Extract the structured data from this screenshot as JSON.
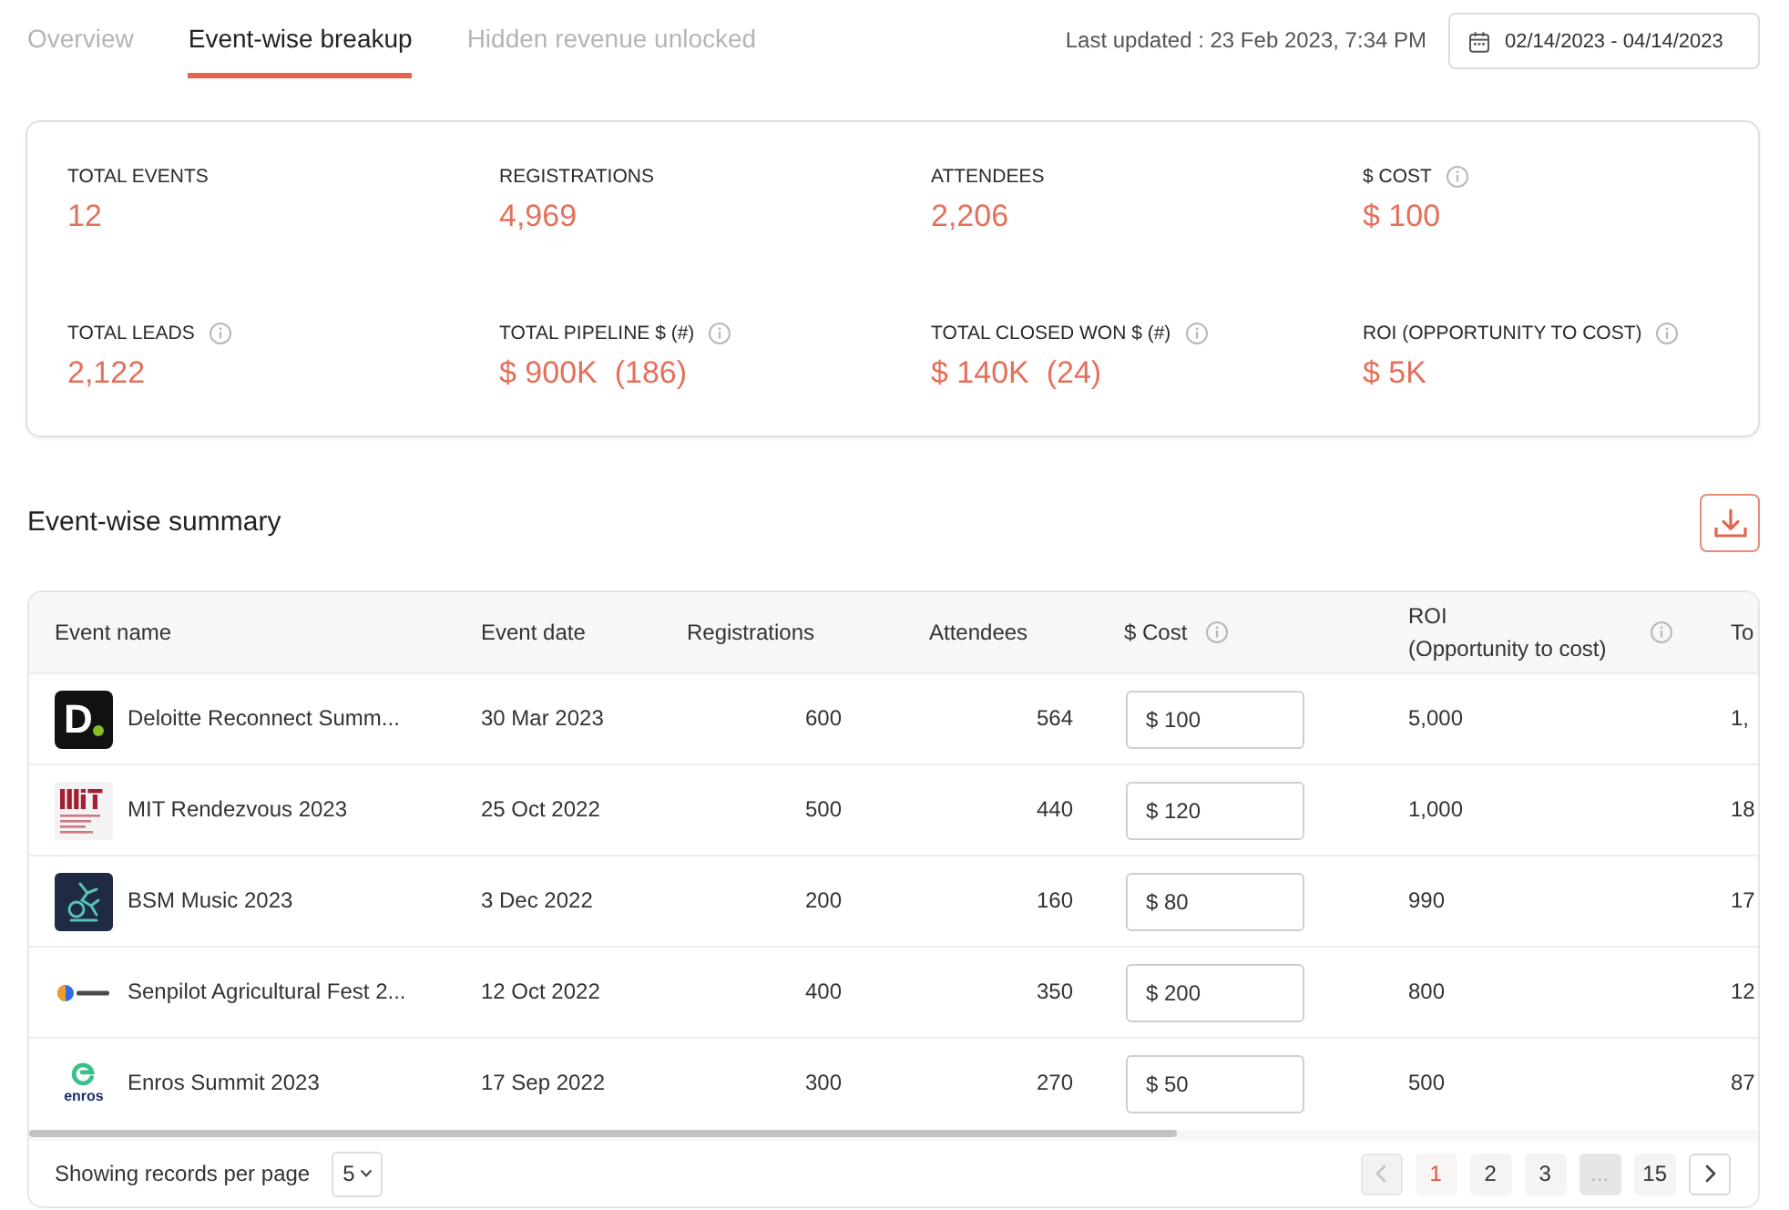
{
  "tabs": [
    {
      "label": "Overview",
      "selected": false
    },
    {
      "label": "Event-wise breakup",
      "selected": true
    },
    {
      "label": "Hidden revenue unlocked",
      "selected": false
    }
  ],
  "last_updated": "Last updated : 23 Feb 2023, 7:34 PM",
  "date_range": "02/14/2023 - 04/14/2023",
  "stats": [
    {
      "label": "TOTAL EVENTS",
      "value": "12",
      "info": false
    },
    {
      "label": "REGISTRATIONS",
      "value": "4,969",
      "info": false
    },
    {
      "label": "ATTENDEES",
      "value": "2,206",
      "info": false
    },
    {
      "label": "$ COST",
      "value": "$ 100",
      "info": true
    },
    {
      "label": "TOTAL LEADS",
      "value": "2,122",
      "info": true
    },
    {
      "label": "TOTAL PIPELINE $ (#)",
      "value": "$ 900K  (186)",
      "info": true
    },
    {
      "label": "TOTAL CLOSED WON $ (#)",
      "value": "$ 140K  (24)",
      "info": true
    },
    {
      "label": "ROI (OPPORTUNITY TO COST)",
      "value": "$ 5K",
      "info": true
    }
  ],
  "summary": {
    "title": "Event-wise summary"
  },
  "table": {
    "columns": [
      {
        "label": "Event name",
        "info": false
      },
      {
        "label": "Event date",
        "info": false
      },
      {
        "label": "Registrations",
        "info": false
      },
      {
        "label": "Attendees",
        "info": false
      },
      {
        "label": "$ Cost",
        "info": true
      },
      {
        "label": "ROI",
        "sublabel": "(Opportunity to cost)",
        "info": true
      },
      {
        "label": "To",
        "info": false
      }
    ],
    "rows": [
      {
        "logo": {
          "kind": "letter-tile",
          "text": "D"
        },
        "event_name": "Deloitte Reconnect Summ...",
        "event_date": "30 Mar 2023",
        "registrations": "600",
        "attendees": "564",
        "cost": "$ 100",
        "roi": "5,000",
        "column_7": "1,"
      },
      {
        "logo": {
          "kind": "bars"
        },
        "event_name": "MIT Rendezvous 2023",
        "event_date": "25 Oct 2022",
        "registrations": "500",
        "attendees": "440",
        "cost": "$ 120",
        "roi": "1,000",
        "column_7": "18"
      },
      {
        "logo": {
          "kind": "art-tile"
        },
        "event_name": "BSM Music 2023",
        "event_date": "3 Dec 2022",
        "registrations": "200",
        "attendees": "160",
        "cost": "$ 80",
        "roi": "990",
        "column_7": "17"
      },
      {
        "logo": {
          "kind": "dot-wordmark"
        },
        "event_name": "Senpilot Agricultural Fest 2...",
        "event_date": "12 Oct 2022",
        "registrations": "400",
        "attendees": "350",
        "cost": "$ 200",
        "roi": "800",
        "column_7": "12"
      },
      {
        "logo": {
          "kind": "ring-wordmark",
          "text": "enros"
        },
        "event_name": "Enros Summit 2023",
        "event_date": "17 Sep 2022",
        "registrations": "300",
        "attendees": "270",
        "cost": "$ 50",
        "roi": "500",
        "column_7": "87"
      }
    ]
  },
  "footer": {
    "records_label": "Showing records per page",
    "per_page": "5",
    "prev": {
      "disabled": true
    },
    "pages": [
      {
        "kind": "page",
        "label": "1",
        "selected": true
      },
      {
        "kind": "page",
        "label": "2",
        "selected": false
      },
      {
        "kind": "page",
        "label": "3",
        "selected": false
      },
      {
        "kind": "ellipsis",
        "label": "...",
        "selected": false
      },
      {
        "kind": "page",
        "label": "15",
        "selected": false
      }
    ],
    "next": {
      "disabled": false
    }
  }
}
